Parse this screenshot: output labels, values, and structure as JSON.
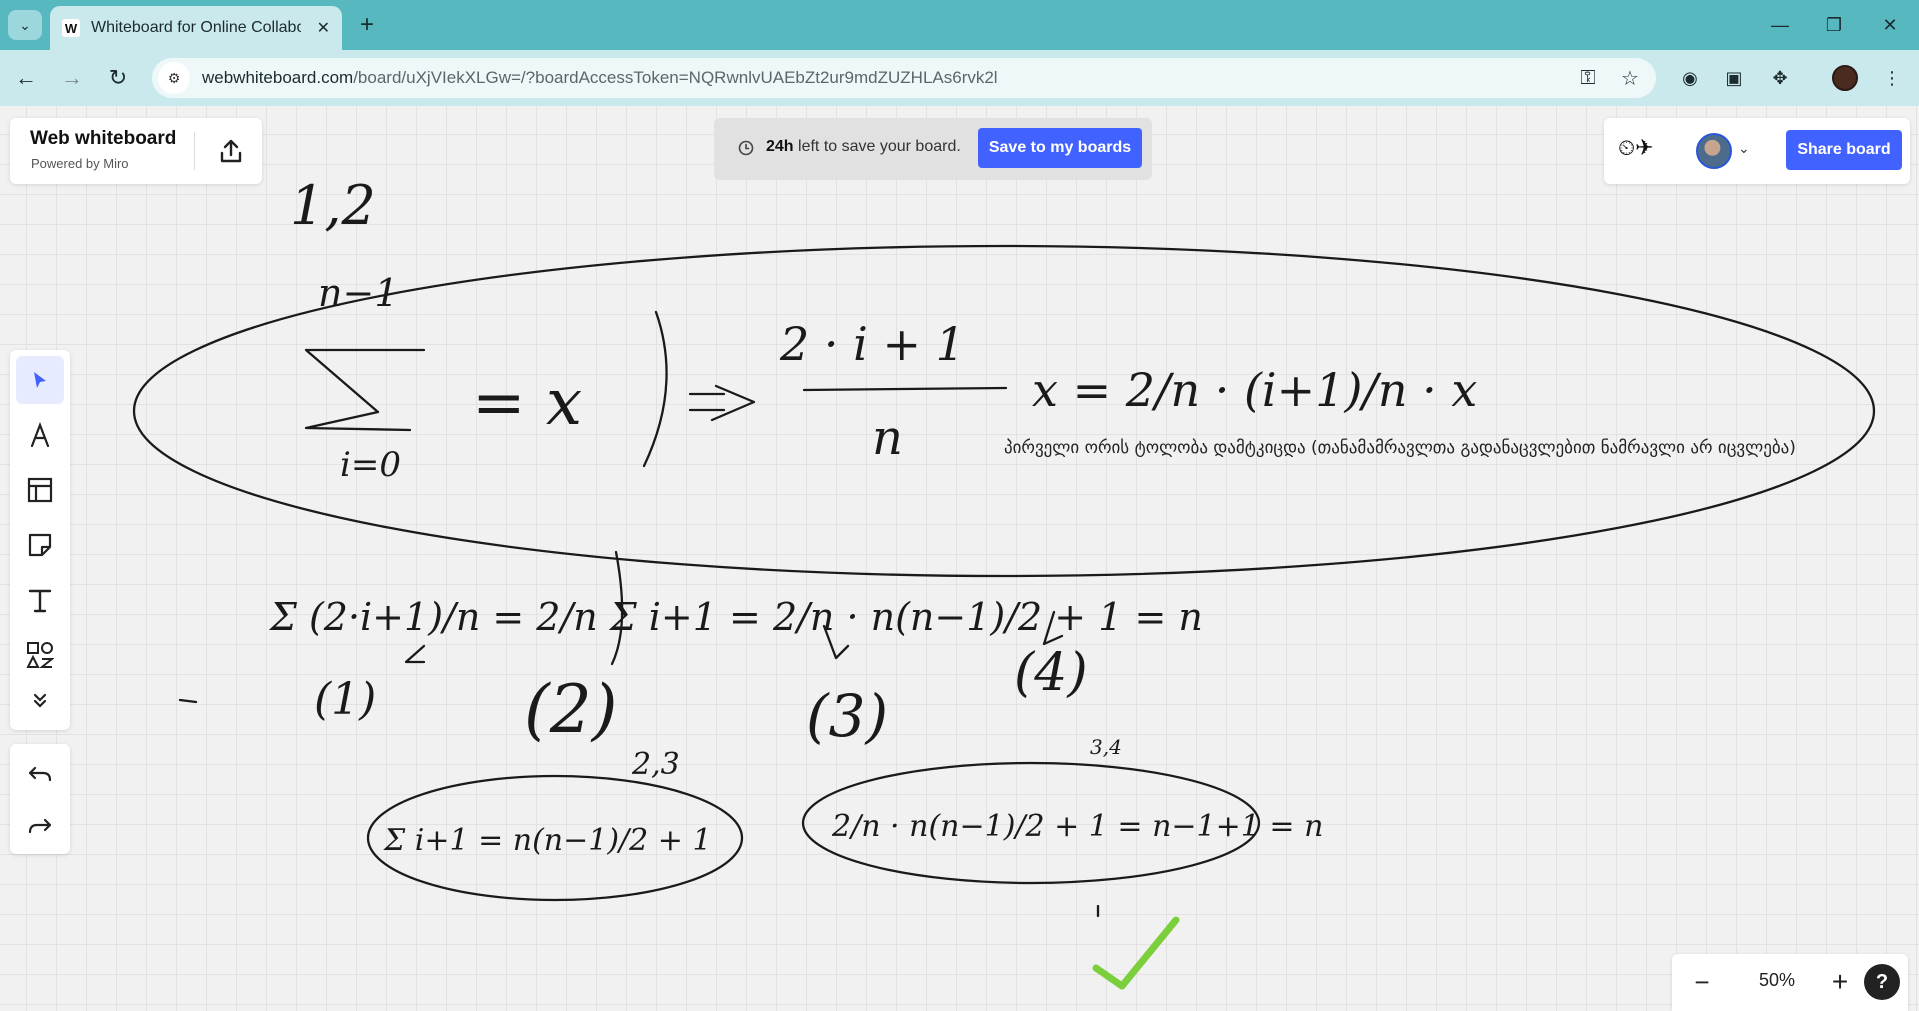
{
  "browser": {
    "tab_title": "Whiteboard for Online Collabor",
    "tab_favicon": "W",
    "url_host": "webwhiteboard.com",
    "url_path": "/board/uXjVIekXLGw=/?boardAccessToken=NQRwnlvUAEbZt2ur9mdZUZHLAs6rvk2l"
  },
  "brand": {
    "title": "Web whiteboard",
    "subtitle": "Powered by Miro"
  },
  "banner": {
    "bold": "24h",
    "text": " left to save your board.",
    "save_label": "Save to my boards"
  },
  "header": {
    "share_label": "Share board",
    "accent_color": "#4262ff"
  },
  "zoom": {
    "value": "50%"
  },
  "canvas": {
    "note": "პირველი ორის ტოლობა დამტკიცდა (თანამამრავლთა გადანაცვლებით ნამრავლი არ იცვლება)",
    "ink": {
      "top_label": "1,2",
      "sum_upper": "n−1",
      "sum_lower": "i=0",
      "eq1": "= x",
      "frac_num": "2 · i + 1",
      "frac_den": "n",
      "rhs": "x = 2/n · (i+1)/n · x",
      "line2": "Σ (2·i+1)/n = 2/n Σ i+1 = 2/n · n(n−1)/2 + 1 = n",
      "lbl1": "(1)",
      "lbl2": "(2)",
      "lbl23": "2,3",
      "lbl3": "(3)",
      "lbl4": "(4)",
      "lbl34": "3,4",
      "ellipse_left": "Σ i+1 = n(n−1)/2 + 1",
      "ellipse_right": "2/n · n(n−1)/2 + 1 = n−1+1 = n",
      "check_color": "#7ccf3c"
    }
  }
}
